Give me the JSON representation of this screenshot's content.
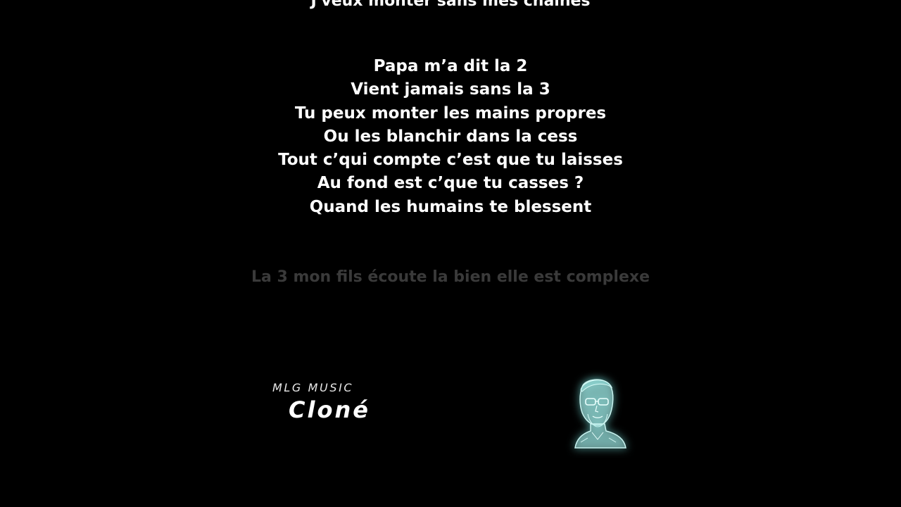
{
  "lyrics": {
    "previous_line": "J'veux monter sans mes chaînes",
    "current_verse": [
      "Papa m’a dit la 2",
      "Vient jamais sans la 3",
      "Tu peux monter les mains propres",
      "Ou les blanchir dans la cess",
      "Tout c’qui compte c’est que tu laisses",
      "Au fond est c’que tu casses ?",
      "Quand les humains te blessent"
    ],
    "next_line": "La 3 mon fils écoute la bien elle est complexe"
  },
  "track": {
    "label": "MLG MUSIC",
    "artist": "Cloné"
  },
  "artwork": {
    "icon": "artist-portrait-icon",
    "glow_color": "#6fd3cf",
    "fill_color": "#a7e6e2"
  },
  "colors": {
    "background": "#000000",
    "active_text": "#ffffff",
    "inactive_text": "#3a3a3a"
  }
}
